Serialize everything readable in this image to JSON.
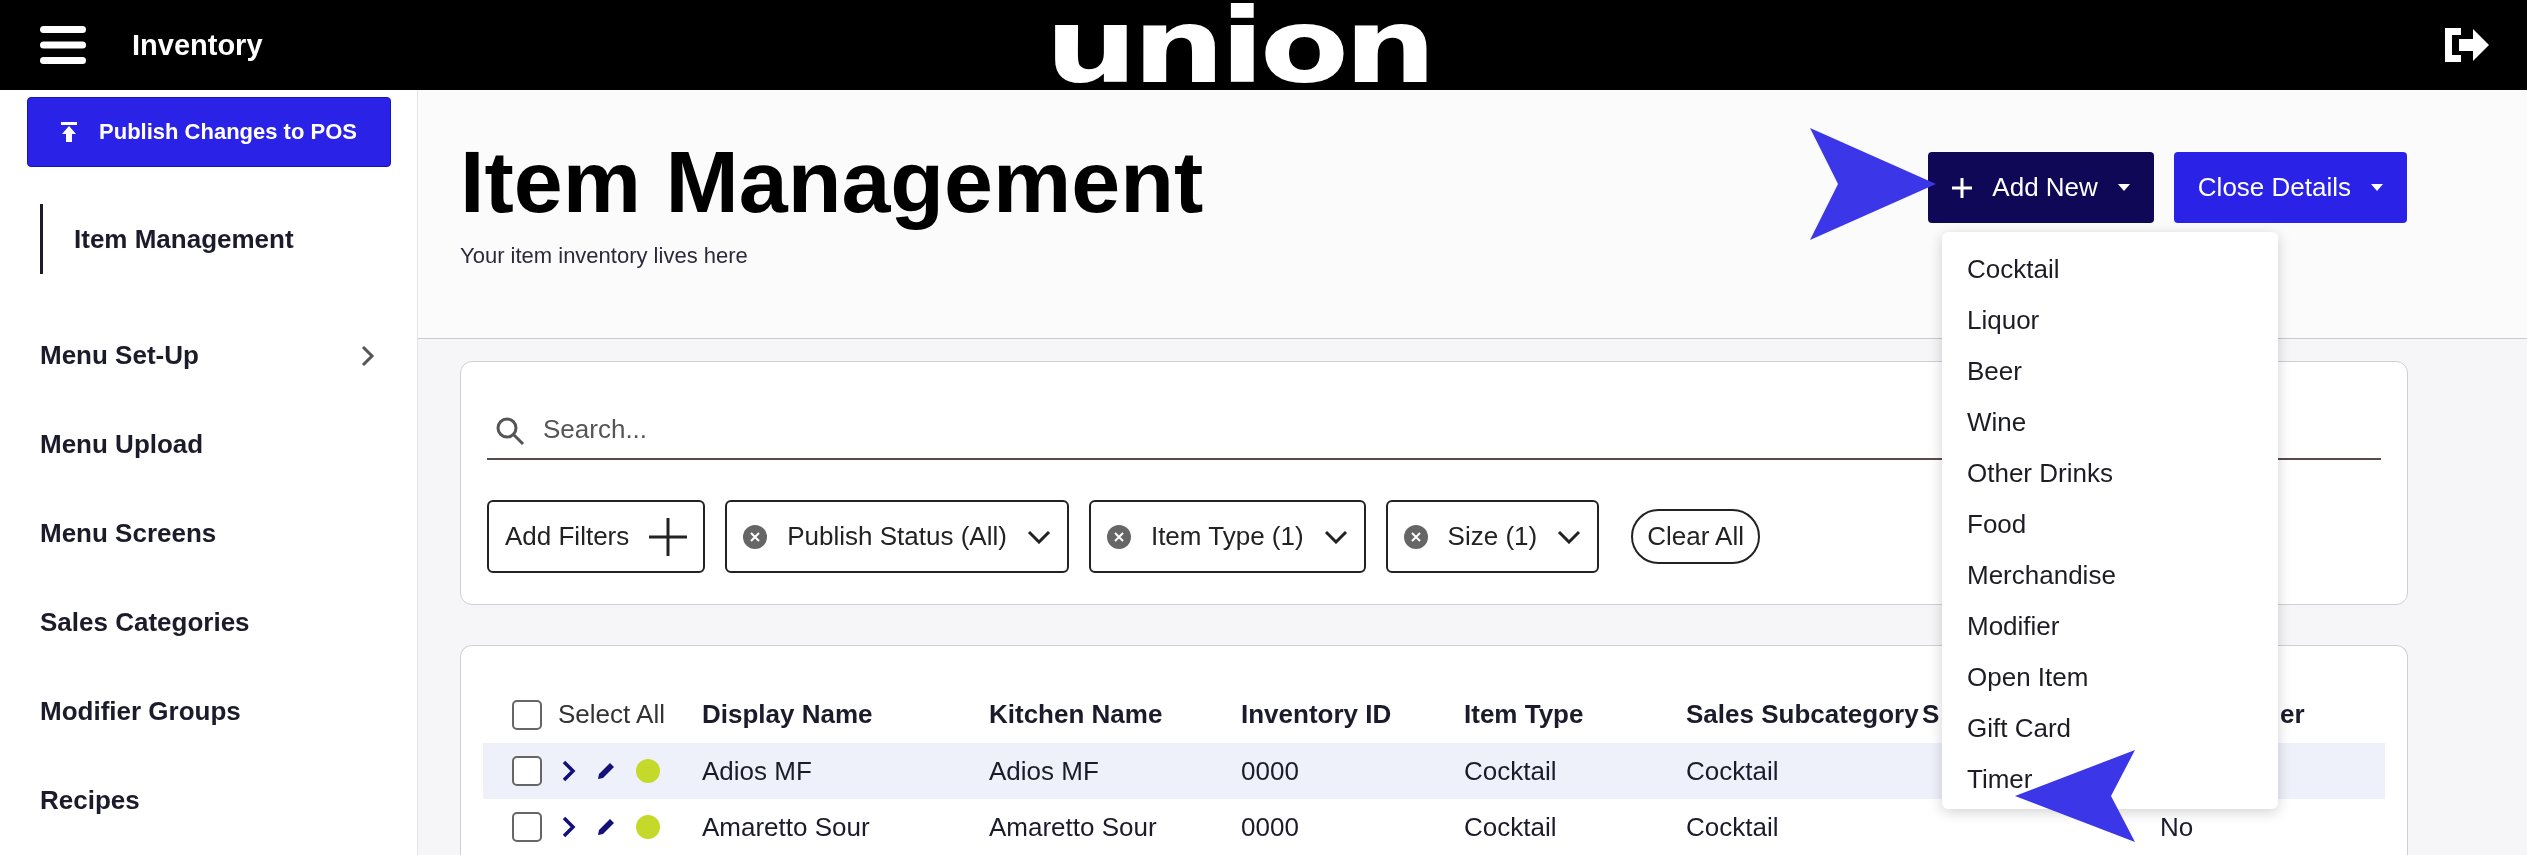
{
  "top_bar": {
    "title": "Inventory",
    "logo": "union"
  },
  "sidebar": {
    "publish_button": "Publish Changes to POS",
    "items": [
      {
        "label": "Item Management",
        "selected": true,
        "has_submenu": false
      },
      {
        "label": "Menu Set-Up",
        "selected": false,
        "has_submenu": true
      },
      {
        "label": "Menu Upload",
        "selected": false,
        "has_submenu": false
      },
      {
        "label": "Menu Screens",
        "selected": false,
        "has_submenu": false
      },
      {
        "label": "Sales Categories",
        "selected": false,
        "has_submenu": false
      },
      {
        "label": "Modifier Groups",
        "selected": false,
        "has_submenu": false
      },
      {
        "label": "Recipes",
        "selected": false,
        "has_submenu": false
      }
    ]
  },
  "header": {
    "title": "Item Management",
    "subtitle": "Your item inventory lives here",
    "add_button": "Add New",
    "close_button": "Close Details",
    "add_menu": [
      "Cocktail",
      "Liquor",
      "Beer",
      "Wine",
      "Other Drinks",
      "Food",
      "Merchandise",
      "Modifier",
      "Open Item",
      "Gift Card",
      "Timer"
    ]
  },
  "search": {
    "placeholder": "Search..."
  },
  "filters": {
    "add": "Add Filters",
    "chips": [
      "Publish Status (All)",
      "Item Type (1)",
      "Size (1)"
    ],
    "clear": "Clear All"
  },
  "table": {
    "select_all": "Select All",
    "select_all_checked": false,
    "columns": [
      "Display Name",
      "Kitchen Name",
      "Inventory ID",
      "Item Type",
      "Sales Subcategory",
      "S",
      "er"
    ],
    "rows": [
      {
        "highlighted": true,
        "checked": false,
        "color": "#c5d92a",
        "cells": [
          "Adios MF",
          "Adios MF",
          "0000",
          "Cocktail",
          "Cocktail",
          "",
          ""
        ]
      },
      {
        "highlighted": false,
        "checked": false,
        "color": "#c5d92a",
        "cells": [
          "Amaretto Sour",
          "Amaretto Sour",
          "0000",
          "Cocktail",
          "Cocktail",
          "",
          "No"
        ]
      }
    ]
  }
}
